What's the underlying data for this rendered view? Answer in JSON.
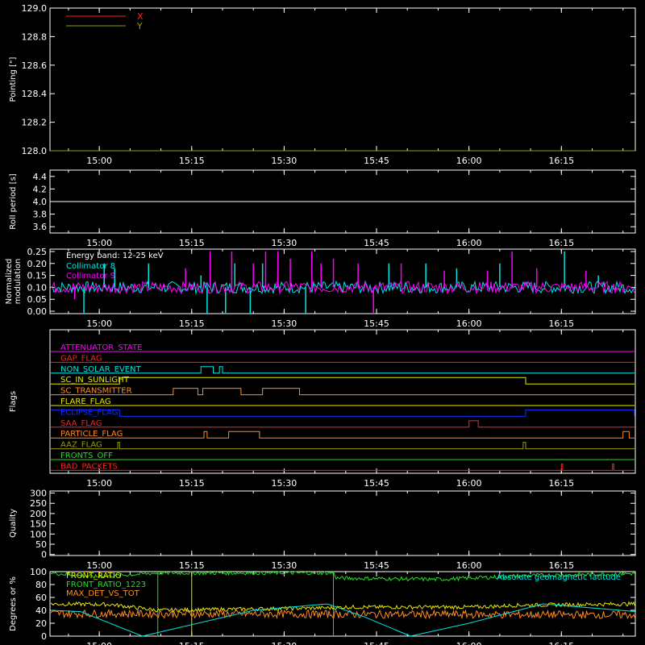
{
  "time_axis": {
    "ticks": [
      "15:00",
      "15:15",
      "15:30",
      "15:45",
      "16:00",
      "16:15"
    ],
    "tick_minutes": [
      900,
      915,
      930,
      945,
      960,
      975
    ],
    "range_minutes": [
      892,
      987
    ]
  },
  "colors": {
    "background": "#000000",
    "axes": "#ffffff",
    "red": "#ff2020",
    "olive": "#9a9a10",
    "cyan": "#00e6e6",
    "magenta": "#ff00ff",
    "orange": "#ff8c20",
    "yellow": "#e8e800",
    "blue": "#1030ff",
    "green": "#20e020"
  },
  "chart_data": [
    {
      "type": "line",
      "name": "pointing",
      "ylabel": "Pointing [\"]",
      "ylim": [
        128.0,
        129.0
      ],
      "yticks": [
        "128.0",
        "128.2",
        "128.4",
        "128.6",
        "128.8",
        "129.0"
      ],
      "legend": "top-left",
      "series": [
        {
          "name": "X",
          "color": "#ff2020",
          "x": [
            892,
            987
          ],
          "values": [
            128.0,
            128.0
          ]
        },
        {
          "name": "Y",
          "color": "#9a9a10",
          "x": [
            892,
            987
          ],
          "values": [
            128.0,
            128.0
          ]
        }
      ]
    },
    {
      "type": "line",
      "name": "roll",
      "ylabel": "Roll period [s]",
      "ylim": [
        3.5,
        4.5
      ],
      "yticks": [
        "3.6",
        "3.8",
        "4.0",
        "4.2",
        "4.4"
      ],
      "series": [
        {
          "color": "#ffffff",
          "x": [
            892,
            987
          ],
          "values": [
            4.0,
            4.0
          ]
        }
      ]
    },
    {
      "type": "line",
      "name": "modulation",
      "ylabel": [
        "Normalized",
        "modulation"
      ],
      "ylim": [
        -0.01,
        0.26
      ],
      "yticks": [
        "0.00",
        "0.05",
        "0.10",
        "0.15",
        "0.20",
        "0.25"
      ],
      "legend": "top-left",
      "annotation": "Energy band: 12-25 keV",
      "series": [
        {
          "name": "Collimator 8",
          "color": "#00e6e6",
          "baseline": 0.1,
          "spikes": [
            [
              897.5,
              -0.01
            ],
            [
              900.8,
              0.2
            ],
            [
              902.5,
              0.18
            ],
            [
              908,
              0.2
            ],
            [
              916.5,
              0.15
            ],
            [
              917.5,
              -0.01
            ],
            [
              920.5,
              -0.01
            ],
            [
              922,
              0.2
            ],
            [
              924.5,
              -0.01
            ],
            [
              926.5,
              0.2
            ],
            [
              933.5,
              -0.01
            ],
            [
              947,
              0.2
            ],
            [
              953,
              0.2
            ],
            [
              958,
              0.18
            ],
            [
              965,
              0.2
            ],
            [
              975.5,
              0.25
            ],
            [
              981,
              0.15
            ]
          ]
        },
        {
          "name": "Collimator 9",
          "color": "#ff00ff",
          "baseline": 0.1,
          "spikes": [
            [
              896,
              0.05
            ],
            [
              914,
              0.18
            ],
            [
              918,
              0.25
            ],
            [
              921.5,
              0.25
            ],
            [
              925,
              0.2
            ],
            [
              927,
              0.25
            ],
            [
              929,
              0.25
            ],
            [
              931,
              0.22
            ],
            [
              934.5,
              0.25
            ],
            [
              936,
              0.2
            ],
            [
              938,
              0.22
            ],
            [
              942,
              0.2
            ],
            [
              944.5,
              -0.01
            ],
            [
              949,
              0.2
            ],
            [
              956,
              0.17
            ],
            [
              963,
              0.17
            ],
            [
              967,
              0.25
            ],
            [
              971,
              0.18
            ],
            [
              979,
              0.17
            ]
          ]
        }
      ]
    },
    {
      "type": "line",
      "name": "flags",
      "ylabel": "Flags",
      "flags": [
        {
          "label": "ATTENUATOR_STATE",
          "color": "#ff00ff",
          "on": []
        },
        {
          "label": "GAP_FLAG",
          "color": "#ff2020",
          "on": []
        },
        {
          "label": "NON_SOLAR_EVENT",
          "color": "#00e6e6",
          "on": [
            [
              916.5,
              918.5
            ],
            [
              919.5,
              920
            ]
          ]
        },
        {
          "label": "SC_IN_SUNLIGHT",
          "color": "#e8e800",
          "on": [
            [
              903.3,
              969.2
            ]
          ]
        },
        {
          "label": "SC_TRANSMITTER",
          "color": "#ff8c20",
          "on": [
            [
              912,
              916
            ],
            [
              916.8,
              923
            ],
            [
              926.5,
              932.5
            ]
          ]
        },
        {
          "label": "FLARE_FLAG",
          "color": "#e8e800",
          "on": []
        },
        {
          "label": "ECLIPSE_FLAG",
          "color": "#1030ff",
          "on": [
            [
              892,
              903.3
            ],
            [
              969.2,
              987
            ]
          ]
        },
        {
          "label": "SAA_FLAG",
          "color": "#ff2020",
          "on": [
            [
              960,
              961.5
            ]
          ]
        },
        {
          "label": "PARTICLE_FLAG",
          "color": "#ff8c20",
          "on": [
            [
              917,
              917.5
            ],
            [
              921,
              926
            ],
            [
              985,
              986
            ]
          ]
        },
        {
          "label": "AAZ_FLAG",
          "color": "#9a9a10",
          "on": [
            [
              903,
              903.3
            ],
            [
              968.8,
              969.2
            ]
          ]
        },
        {
          "label": "FRONTS_OFF",
          "color": "#20e020",
          "on": []
        },
        {
          "label": "BAD_PACKETS",
          "color": "#ff2020",
          "on": [
            [
              975,
              975.2
            ],
            [
              983.3,
              983.5
            ]
          ]
        }
      ]
    },
    {
      "type": "line",
      "name": "quality",
      "ylabel": "Quality",
      "ylim": [
        -5,
        310
      ],
      "yticks": [
        "0",
        "50",
        "100",
        "150",
        "200",
        "250",
        "300"
      ],
      "series": []
    },
    {
      "type": "line",
      "name": "geo",
      "ylabel": "Degrees or %",
      "ylim": [
        0,
        100
      ],
      "yticks": [
        "0",
        "20",
        "40",
        "60",
        "80",
        "100"
      ],
      "legend": "top-left",
      "series": [
        {
          "name": "FRONT_RATIO",
          "color": "#e8e800",
          "x": [
            892,
            902,
            909.5,
            938,
            940,
            960,
            964,
            968,
            987
          ],
          "values": [
            50,
            49,
            40,
            44,
            45,
            45,
            46,
            48,
            50
          ]
        },
        {
          "name": "FRONT_RATIO_1223",
          "color": "#20e020",
          "x": [
            892,
            899.5,
            909.5,
            938,
            938.5,
            955,
            970,
            987
          ],
          "values": [
            98,
            92,
            98,
            98,
            90,
            88,
            94,
            97
          ]
        },
        {
          "name": "MAX_DET_VS_TOT",
          "color": "#ff8c20",
          "x": [
            892,
            987
          ],
          "values": [
            35,
            33
          ]
        },
        {
          "name": "Absolute geomagnetic latitude",
          "color": "#00e6e6",
          "x": [
            892,
            897,
            907,
            925,
            937,
            943,
            950.5,
            960,
            972,
            987
          ],
          "values": [
            40,
            38,
            0,
            40,
            50,
            30,
            0,
            20,
            50,
            38
          ]
        }
      ],
      "vlines": [
        {
          "x": 909.5,
          "color": "#20e020"
        },
        {
          "x": 938,
          "color": "#20e020"
        },
        {
          "x": 915,
          "color": "#e8e800"
        }
      ]
    }
  ]
}
